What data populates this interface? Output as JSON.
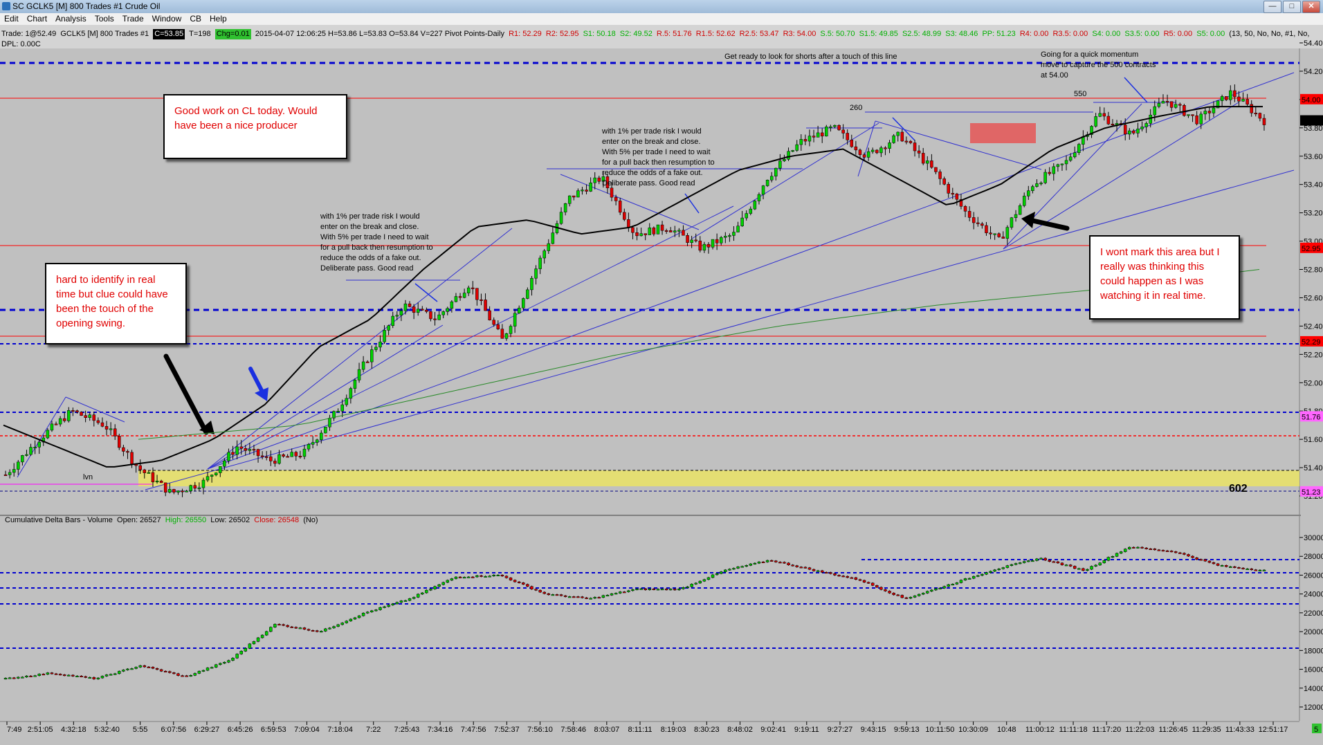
{
  "window": {
    "title": "SC GCLK5 [M]  800 Trades  #1  Crude Oil",
    "controls": [
      "—",
      "□",
      "✕"
    ]
  },
  "menu": [
    "Edit",
    "Chart",
    "Analysis",
    "Tools",
    "Trade",
    "Window",
    "CB",
    "Help"
  ],
  "infobar": {
    "trade": "Trade: 1@52.49",
    "symbol": "GCLK5 [M]  800 Trades  #1",
    "close": "C=53.85",
    "t": "T=198",
    "chg": "Chg=0.01",
    "ohlc": "2015-04-07 12:06:25 H=53.86 L=53.83 O=53.84 V=227 Pivot Points-Daily",
    "red_levels": [
      "R1: 52.29",
      "R2: 52.95"
    ],
    "green_levels_1": [
      "S1: 50.18",
      "S2: 49.52"
    ],
    "red_levels_2": [
      "R.5: 51.76",
      "R1.5: 52.62",
      "R2.5: 53.47",
      "R3: 54.00"
    ],
    "green_levels_2": [
      "S.5: 50.70",
      "S1.5: 49.85",
      "S2.5: 48.99",
      "S3: 48.46",
      "PP: 51.23"
    ],
    "red_levels_3": [
      "R4: 0.00",
      "R3.5: 0.00"
    ],
    "green_levels_3": [
      "S4: 0.00",
      "S3.5: 0.00"
    ],
    "red_levels_4": [
      "R5: 0.00"
    ],
    "green_levels_4": [
      "S5: 0.00"
    ],
    "tail": "(13, 50, No, No, #1, No,",
    "dpl": "DPL: 0.00C"
  },
  "annotations": {
    "good_work": "Good work on CL today.  Would have been a nice producer",
    "hard_to_identify": "hard to identify in real time but clue could have been the touch of the opening swing.",
    "wont_mark": "I wont mark this area but I really was thinking this could happen as I was watching it in real time.",
    "note1": "with 1% per trade risk I would\nenter on the break and close.\nWith 5% per trade I need to wait\nfor a pull back then resumption to\nreduce the odds of a fake out.\nDeliberate pass.  Good read",
    "note2": "with 1% per trade risk I would\nenter on the break and close.\nWith 5% per trade I need to wait\nfor a pull back then resumption to\nreduce the odds of a fake out.\nDeliberate pass.  Good read",
    "shorts": "Get ready to look for shorts after a touch of this line",
    "momentum": "Going for a quick momentum\nmove to capture the 500 contracts\nat 54.00",
    "label_550": "550",
    "label_260": "260",
    "label_lvn": "lvn",
    "label_602": "602"
  },
  "lower_panel": {
    "name": "Cumulative Delta Bars - Volume",
    "open": "Open: 26527",
    "high": "High: 26550",
    "low": "Low: 26502",
    "close": "Close: 26548",
    "tail": "(No)"
  },
  "price_axis": {
    "ticks": [
      "54.40",
      "54.20",
      "54.00",
      "53.80",
      "53.60",
      "53.40",
      "53.20",
      "53.00",
      "52.80",
      "52.60",
      "52.40",
      "52.20",
      "52.00",
      "51.80",
      "51.60",
      "51.40",
      "51.20"
    ],
    "markers": [
      {
        "label": "54.00",
        "bg": "#ff0000"
      },
      {
        "label": "53.85",
        "bg": "#000000"
      },
      {
        "label": "52.95",
        "bg": "#ff0000"
      },
      {
        "label": "52.29",
        "bg": "#ff0000"
      },
      {
        "label": "51.76",
        "bg": "#ff66ff"
      },
      {
        "label": "51.23",
        "bg": "#ff66ff"
      }
    ]
  },
  "delta_axis": {
    "ticks": [
      "30000",
      "28000",
      "26000",
      "24000",
      "22000",
      "20000",
      "18000",
      "16000",
      "14000",
      "12000"
    ]
  },
  "time_axis": {
    "ticks": [
      "7:49",
      "2:51:05",
      "4:32:18",
      "5:32:40",
      "5:55",
      "6:07:56",
      "6:29:27",
      "6:45:26",
      "6:59:53",
      "7:09:04",
      "7:18:04",
      "7:22",
      "7:25:43",
      "7:34:16",
      "7:47:56",
      "7:52:37",
      "7:56:10",
      "7:58:46",
      "8:03:07",
      "8:11:11",
      "8:19:03",
      "8:30:23",
      "8:48:02",
      "9:02:41",
      "9:19:11",
      "9:27:27",
      "9:43:15",
      "9:59:13",
      "10:11:50",
      "10:30:09",
      "10:48",
      "11:00:12",
      "11:11:18",
      "11:17:20",
      "11:22:03",
      "11:26:45",
      "11:29:35",
      "11:43:33",
      "12:51:17"
    ],
    "corner": "5"
  },
  "chart_data": {
    "type": "candlestick",
    "price_path": [
      51.35,
      51.6,
      51.8,
      51.7,
      51.4,
      51.22,
      51.3,
      51.55,
      51.45,
      51.5,
      51.8,
      52.2,
      52.55,
      52.45,
      52.7,
      52.3,
      52.8,
      53.3,
      53.45,
      53.05,
      53.1,
      52.95,
      53.05,
      53.45,
      53.7,
      53.8,
      53.6,
      53.75,
      53.5,
      53.2,
      53.0,
      53.4,
      53.55,
      53.9,
      53.75,
      54.0,
      53.85,
      54.05,
      53.85
    ],
    "delta_path": [
      15000,
      15600,
      15000,
      16400,
      15200,
      17000,
      20800,
      20000,
      22000,
      23500,
      25800,
      26000,
      24000,
      23500,
      24500,
      24500,
      26500,
      27600,
      26500,
      25500,
      23500,
      25000,
      26600,
      27800,
      26500,
      29000,
      28500,
      27000,
      26500
    ],
    "sma_path": [
      51.7,
      51.55,
      51.4,
      51.45,
      51.6,
      51.85,
      52.25,
      52.45,
      52.8,
      53.1,
      53.15,
      53.05,
      53.1,
      53.3,
      53.5,
      53.6,
      53.65,
      53.45,
      53.25,
      53.4,
      53.65,
      53.8,
      53.88,
      53.95,
      53.95
    ],
    "slow_ma_path": [
      51.6,
      51.7,
      51.95,
      52.2,
      52.4,
      52.55,
      52.66,
      52.8
    ]
  }
}
